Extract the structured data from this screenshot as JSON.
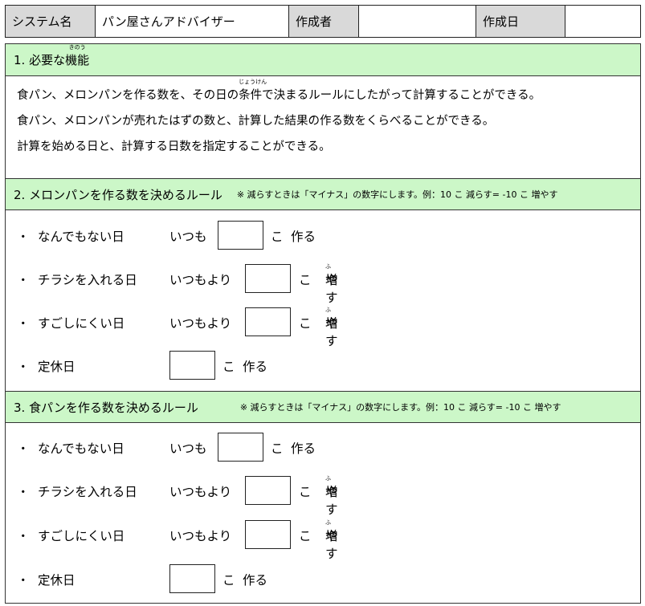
{
  "header": {
    "system_label": "システム名",
    "system_value": "パン屋さんアドバイザー",
    "author_label": "作成者",
    "author_value": "",
    "date_label": "作成日",
    "date_value": ""
  },
  "section1": {
    "title_prefix": "1. 必要な",
    "title_kanji": "機能",
    "title_ruby": "きのう",
    "line1_before": "食パン、メロンパンを作る数を、その日の",
    "line1_kanji": "条件",
    "line1_ruby": "じょうけん",
    "line1_after": "で決まるルールにしたがって計算することができる。",
    "line2": "食パン、メロンパンが売れたはずの数と、計算した結果の作る数をくらべることができる。",
    "line3": "計算を始める日と、計算する日数を指定することができる。"
  },
  "section2": {
    "title": "2. メロンパンを作る数を決めるルール",
    "note": "※ 減らすときは「マイナス」の数字にします。例：10 こ 減らす= -10 こ 増やす"
  },
  "section3": {
    "title": "3. 食パンを作る数を決めるルール",
    "note": "※ 減らすときは「マイナス」の数字にします。例：10 こ 減らす= -10 こ 増やす"
  },
  "rows": {
    "bullet": "・",
    "normal_day": "なんでもない日",
    "flyer_day": "チラシを入れる日",
    "hard_day": "すごしにくい日",
    "holiday": "定休日",
    "always": "いつも",
    "than_always": "いつもより",
    "ko": "こ",
    "make": "作る",
    "increase_kanji": "増",
    "increase_ruby": "ふ",
    "increase_rest": "やす"
  }
}
